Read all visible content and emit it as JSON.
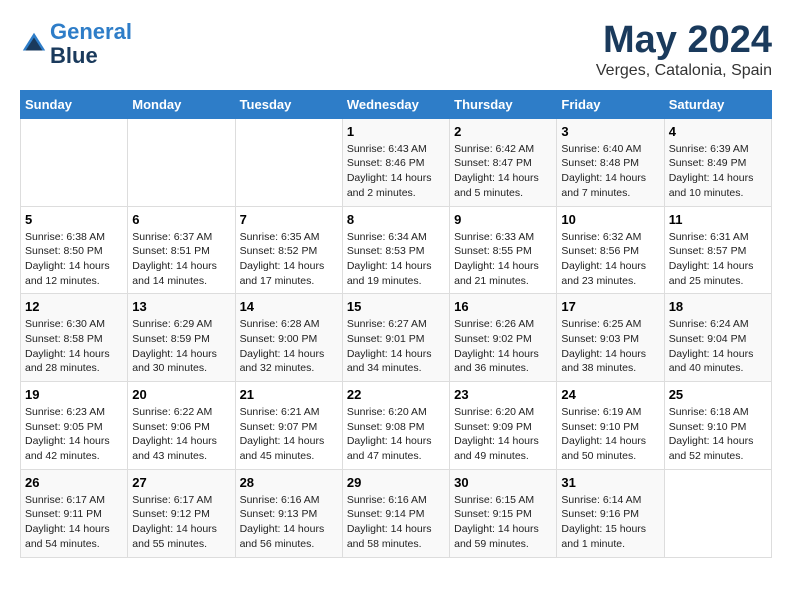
{
  "header": {
    "logo_line1": "General",
    "logo_line2": "Blue",
    "month_title": "May 2024",
    "location": "Verges, Catalonia, Spain"
  },
  "weekdays": [
    "Sunday",
    "Monday",
    "Tuesday",
    "Wednesday",
    "Thursday",
    "Friday",
    "Saturday"
  ],
  "weeks": [
    [
      {
        "day": "",
        "info": ""
      },
      {
        "day": "",
        "info": ""
      },
      {
        "day": "",
        "info": ""
      },
      {
        "day": "1",
        "info": "Sunrise: 6:43 AM\nSunset: 8:46 PM\nDaylight: 14 hours\nand 2 minutes."
      },
      {
        "day": "2",
        "info": "Sunrise: 6:42 AM\nSunset: 8:47 PM\nDaylight: 14 hours\nand 5 minutes."
      },
      {
        "day": "3",
        "info": "Sunrise: 6:40 AM\nSunset: 8:48 PM\nDaylight: 14 hours\nand 7 minutes."
      },
      {
        "day": "4",
        "info": "Sunrise: 6:39 AM\nSunset: 8:49 PM\nDaylight: 14 hours\nand 10 minutes."
      }
    ],
    [
      {
        "day": "5",
        "info": "Sunrise: 6:38 AM\nSunset: 8:50 PM\nDaylight: 14 hours\nand 12 minutes."
      },
      {
        "day": "6",
        "info": "Sunrise: 6:37 AM\nSunset: 8:51 PM\nDaylight: 14 hours\nand 14 minutes."
      },
      {
        "day": "7",
        "info": "Sunrise: 6:35 AM\nSunset: 8:52 PM\nDaylight: 14 hours\nand 17 minutes."
      },
      {
        "day": "8",
        "info": "Sunrise: 6:34 AM\nSunset: 8:53 PM\nDaylight: 14 hours\nand 19 minutes."
      },
      {
        "day": "9",
        "info": "Sunrise: 6:33 AM\nSunset: 8:55 PM\nDaylight: 14 hours\nand 21 minutes."
      },
      {
        "day": "10",
        "info": "Sunrise: 6:32 AM\nSunset: 8:56 PM\nDaylight: 14 hours\nand 23 minutes."
      },
      {
        "day": "11",
        "info": "Sunrise: 6:31 AM\nSunset: 8:57 PM\nDaylight: 14 hours\nand 25 minutes."
      }
    ],
    [
      {
        "day": "12",
        "info": "Sunrise: 6:30 AM\nSunset: 8:58 PM\nDaylight: 14 hours\nand 28 minutes."
      },
      {
        "day": "13",
        "info": "Sunrise: 6:29 AM\nSunset: 8:59 PM\nDaylight: 14 hours\nand 30 minutes."
      },
      {
        "day": "14",
        "info": "Sunrise: 6:28 AM\nSunset: 9:00 PM\nDaylight: 14 hours\nand 32 minutes."
      },
      {
        "day": "15",
        "info": "Sunrise: 6:27 AM\nSunset: 9:01 PM\nDaylight: 14 hours\nand 34 minutes."
      },
      {
        "day": "16",
        "info": "Sunrise: 6:26 AM\nSunset: 9:02 PM\nDaylight: 14 hours\nand 36 minutes."
      },
      {
        "day": "17",
        "info": "Sunrise: 6:25 AM\nSunset: 9:03 PM\nDaylight: 14 hours\nand 38 minutes."
      },
      {
        "day": "18",
        "info": "Sunrise: 6:24 AM\nSunset: 9:04 PM\nDaylight: 14 hours\nand 40 minutes."
      }
    ],
    [
      {
        "day": "19",
        "info": "Sunrise: 6:23 AM\nSunset: 9:05 PM\nDaylight: 14 hours\nand 42 minutes."
      },
      {
        "day": "20",
        "info": "Sunrise: 6:22 AM\nSunset: 9:06 PM\nDaylight: 14 hours\nand 43 minutes."
      },
      {
        "day": "21",
        "info": "Sunrise: 6:21 AM\nSunset: 9:07 PM\nDaylight: 14 hours\nand 45 minutes."
      },
      {
        "day": "22",
        "info": "Sunrise: 6:20 AM\nSunset: 9:08 PM\nDaylight: 14 hours\nand 47 minutes."
      },
      {
        "day": "23",
        "info": "Sunrise: 6:20 AM\nSunset: 9:09 PM\nDaylight: 14 hours\nand 49 minutes."
      },
      {
        "day": "24",
        "info": "Sunrise: 6:19 AM\nSunset: 9:10 PM\nDaylight: 14 hours\nand 50 minutes."
      },
      {
        "day": "25",
        "info": "Sunrise: 6:18 AM\nSunset: 9:10 PM\nDaylight: 14 hours\nand 52 minutes."
      }
    ],
    [
      {
        "day": "26",
        "info": "Sunrise: 6:17 AM\nSunset: 9:11 PM\nDaylight: 14 hours\nand 54 minutes."
      },
      {
        "day": "27",
        "info": "Sunrise: 6:17 AM\nSunset: 9:12 PM\nDaylight: 14 hours\nand 55 minutes."
      },
      {
        "day": "28",
        "info": "Sunrise: 6:16 AM\nSunset: 9:13 PM\nDaylight: 14 hours\nand 56 minutes."
      },
      {
        "day": "29",
        "info": "Sunrise: 6:16 AM\nSunset: 9:14 PM\nDaylight: 14 hours\nand 58 minutes."
      },
      {
        "day": "30",
        "info": "Sunrise: 6:15 AM\nSunset: 9:15 PM\nDaylight: 14 hours\nand 59 minutes."
      },
      {
        "day": "31",
        "info": "Sunrise: 6:14 AM\nSunset: 9:16 PM\nDaylight: 15 hours\nand 1 minute."
      },
      {
        "day": "",
        "info": ""
      }
    ]
  ]
}
